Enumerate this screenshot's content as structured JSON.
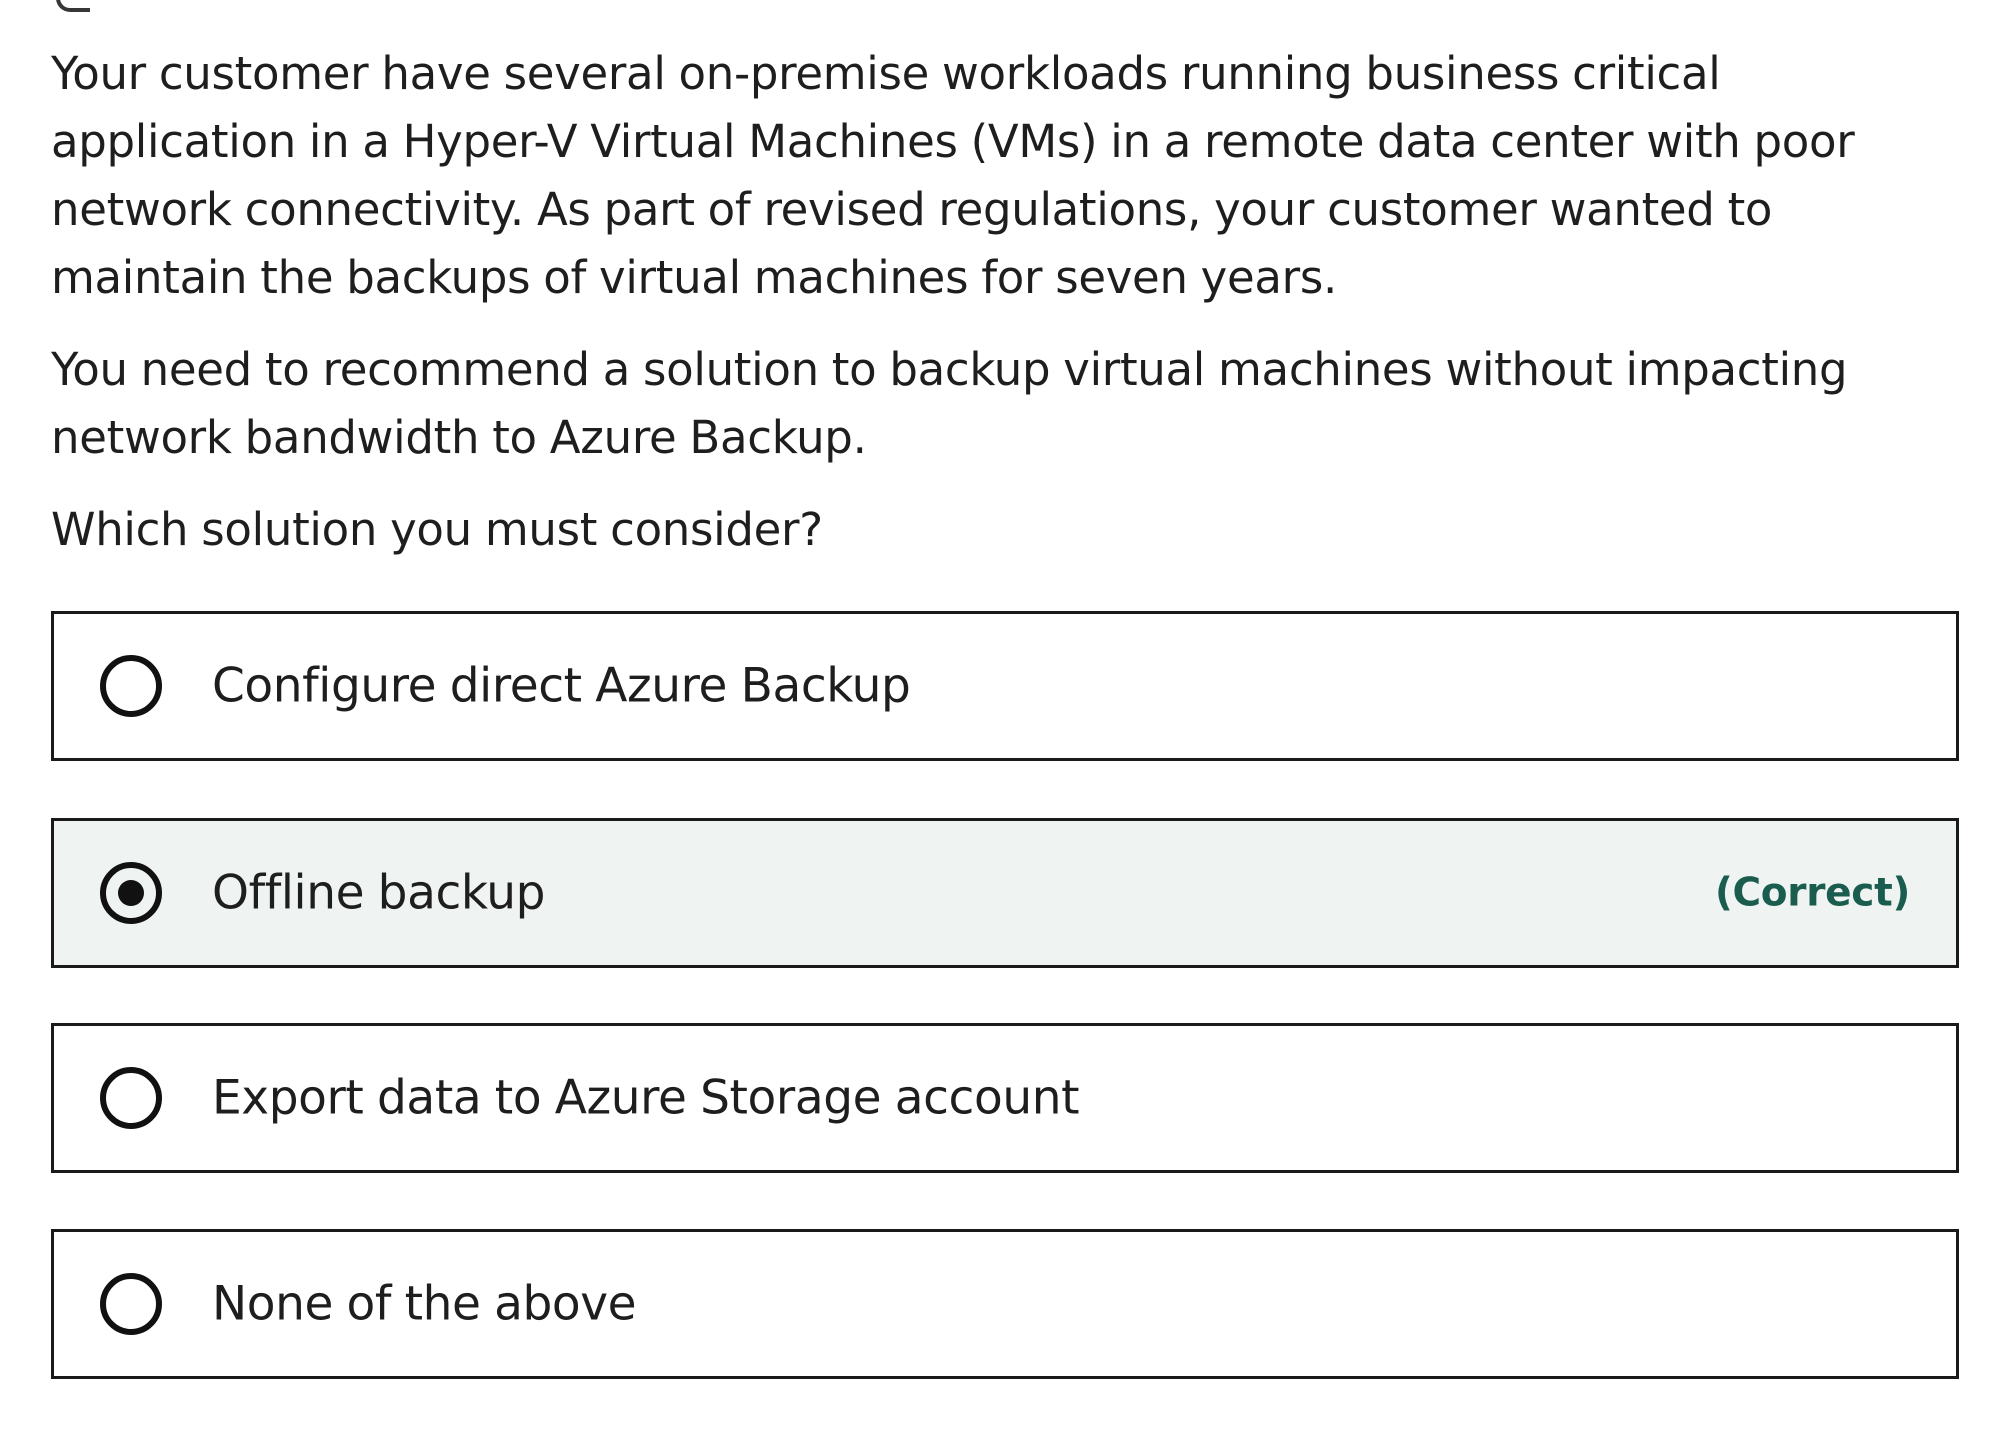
{
  "question": {
    "paragraphs": [
      "Your customer have several on-premise workloads running business critical application in a Hyper-V Virtual Machines (VMs) in a remote data center with poor network connectivity. As part of revised regulations, your customer wanted to maintain the backups of virtual machines for seven years.",
      "You need to recommend a solution to backup virtual machines without impacting network bandwidth to Azure Backup.",
      "Which solution you must consider?"
    ]
  },
  "options": [
    {
      "label": "Configure direct Azure Backup",
      "selected": false,
      "tag": ""
    },
    {
      "label": "Offline backup",
      "selected": true,
      "tag": "(Correct)"
    },
    {
      "label": "Export data to Azure Storage account",
      "selected": false,
      "tag": ""
    },
    {
      "label": "None of the above",
      "selected": false,
      "tag": ""
    }
  ],
  "colors": {
    "selected_background": "#eff4f2",
    "correct_text": "#1a5c4e",
    "border": "#1a1a1a"
  }
}
